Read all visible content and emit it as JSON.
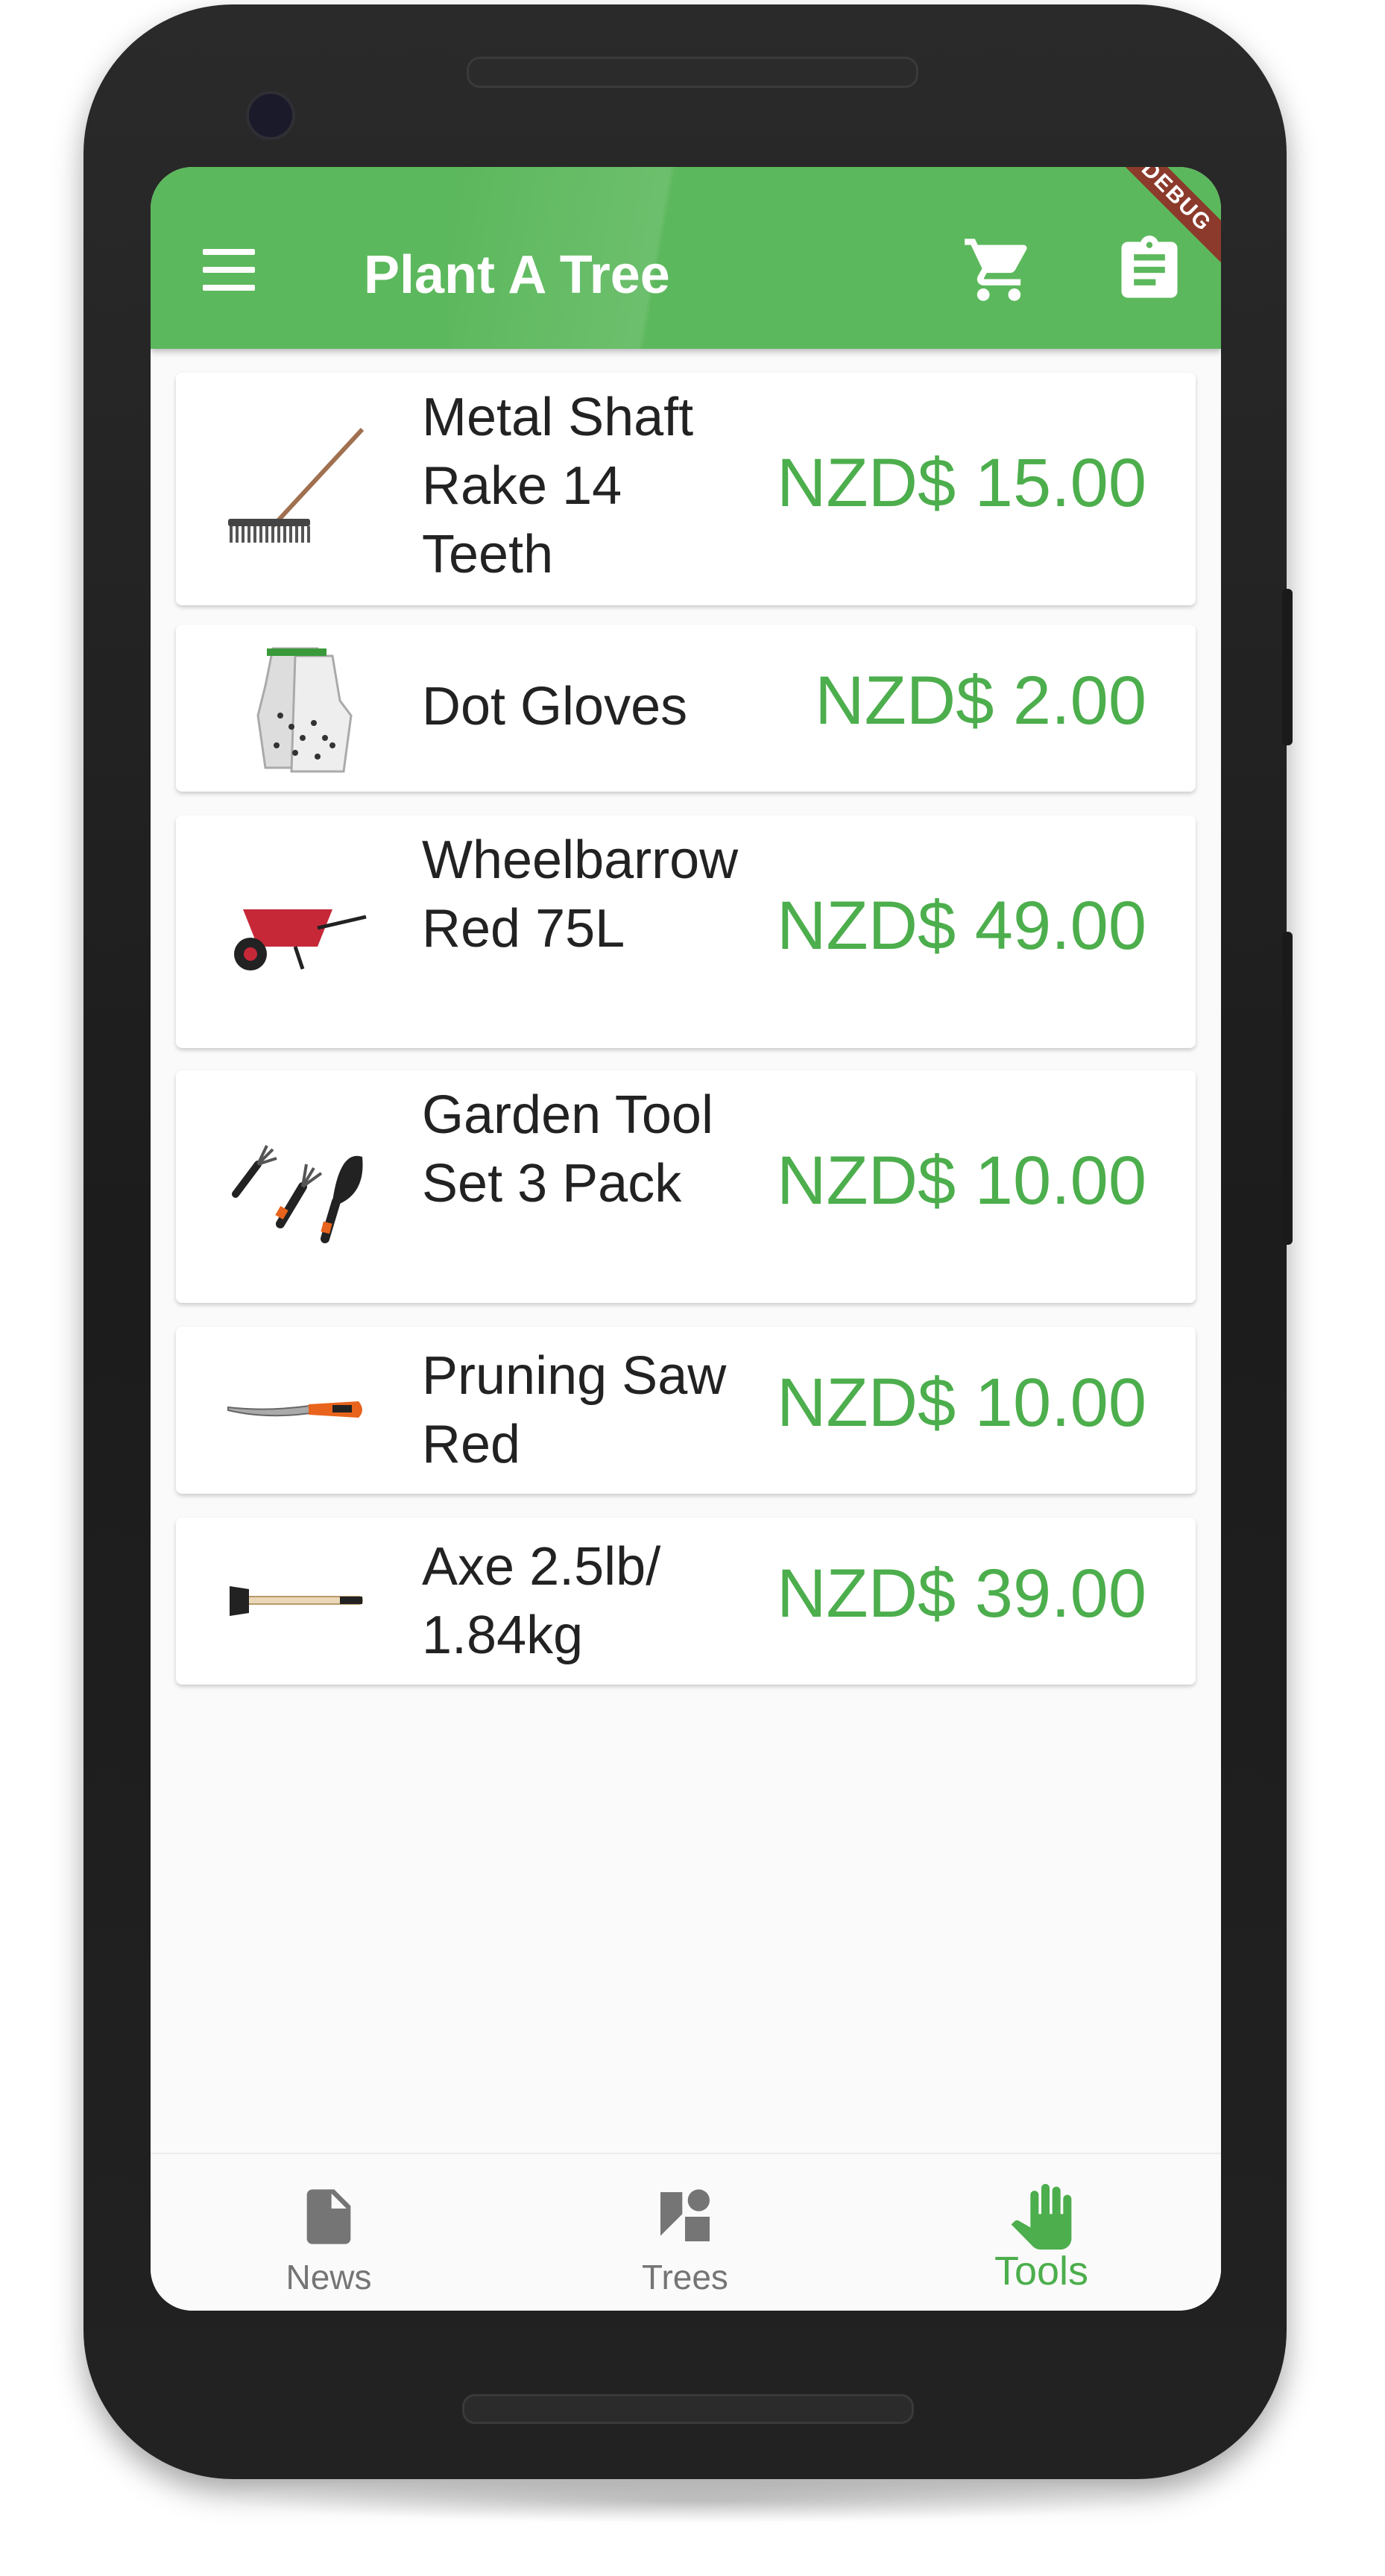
{
  "appbar": {
    "title": "Plant A Tree",
    "debug_banner": "DEBUG",
    "color": "#5cb85c"
  },
  "products": [
    {
      "name": "Metal Shaft Rake 14 Teeth",
      "price": "NZD$ 15.00",
      "icon": "rake-image"
    },
    {
      "name": "Dot Gloves",
      "price": "NZD$ 2.00",
      "icon": "gloves-image"
    },
    {
      "name": "Wheelbarrow Red 75L",
      "price": "NZD$ 49.00",
      "icon": "wheelbarrow-image"
    },
    {
      "name": " Garden Tool Set 3 Pack",
      "price": "NZD$ 10.00",
      "icon": "garden-tool-set-image"
    },
    {
      "name": "Pruning Saw Red",
      "price": "NZD$ 10.00",
      "icon": "pruning-saw-image"
    },
    {
      "name": "Axe 2.5lb/ 1.84kg",
      "price": "NZD$ 39.00",
      "icon": "axe-image"
    }
  ],
  "bottom_nav": [
    {
      "label": "News",
      "icon": "document-icon",
      "active": false
    },
    {
      "label": "Trees",
      "icon": "shapes-icon",
      "active": false
    },
    {
      "label": "Tools",
      "icon": "hand-icon",
      "active": true
    }
  ],
  "colors": {
    "price": "#4cae4c",
    "active_tab": "#4cae4c",
    "inactive_tab": "#757575"
  }
}
